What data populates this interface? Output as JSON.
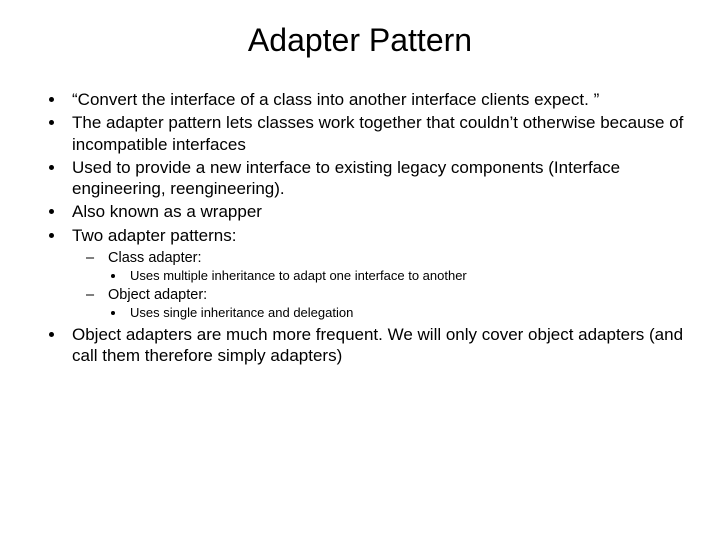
{
  "title": "Adapter Pattern",
  "bullets": {
    "b1": "“Convert the interface of a class into another interface clients expect. ”",
    "b2": "The adapter pattern lets classes work together that couldn’t otherwise because of incompatible interfaces",
    "b3": "Used to provide a new interface to existing legacy components (Interface engineering, reengineering).",
    "b4": "Also known as a wrapper",
    "b5": "Two adapter patterns:",
    "b5_1": "Class adapter:",
    "b5_1_1": "Uses multiple inheritance to adapt one interface to another",
    "b5_2": "Object adapter:",
    "b5_2_1": "Uses single inheritance and delegation",
    "b6": "Object adapters are much more frequent. We will only cover object adapters (and call them therefore simply adapters)"
  }
}
